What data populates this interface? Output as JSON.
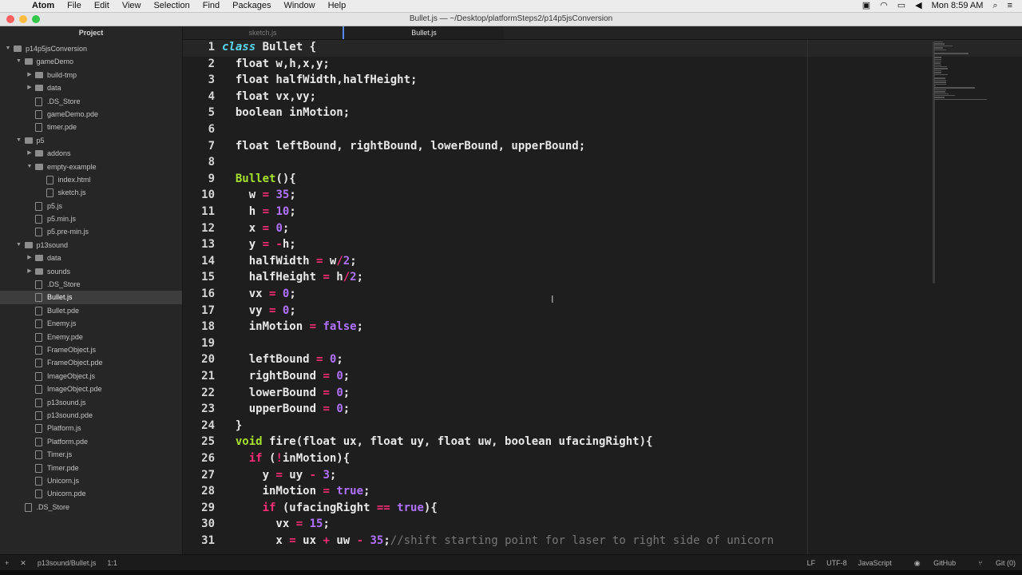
{
  "menubar": {
    "apple": "",
    "app": "Atom",
    "items": [
      "File",
      "Edit",
      "View",
      "Selection",
      "Find",
      "Packages",
      "Window",
      "Help"
    ],
    "clock": "Mon 8:59 AM"
  },
  "window": {
    "title": "Bullet.js — ~/Desktop/platformSteps2/p14p5jsConversion"
  },
  "sidebar": {
    "title": "Project",
    "tree": [
      {
        "label": "p14p5jsConversion",
        "type": "folder",
        "depth": 0,
        "open": true
      },
      {
        "label": "gameDemo",
        "type": "folder",
        "depth": 1,
        "open": true
      },
      {
        "label": "build-tmp",
        "type": "folder",
        "depth": 2,
        "open": false
      },
      {
        "label": "data",
        "type": "folder",
        "depth": 2,
        "open": false
      },
      {
        "label": ".DS_Store",
        "type": "file",
        "depth": 2
      },
      {
        "label": "gameDemo.pde",
        "type": "file",
        "depth": 2
      },
      {
        "label": "timer.pde",
        "type": "file",
        "depth": 2
      },
      {
        "label": "p5",
        "type": "folder",
        "depth": 1,
        "open": true
      },
      {
        "label": "addons",
        "type": "folder",
        "depth": 2,
        "open": false
      },
      {
        "label": "empty-example",
        "type": "folder",
        "depth": 2,
        "open": true
      },
      {
        "label": "index.html",
        "type": "file",
        "depth": 3
      },
      {
        "label": "sketch.js",
        "type": "file",
        "depth": 3
      },
      {
        "label": "p5.js",
        "type": "file",
        "depth": 2
      },
      {
        "label": "p5.min.js",
        "type": "file",
        "depth": 2
      },
      {
        "label": "p5.pre-min.js",
        "type": "file",
        "depth": 2
      },
      {
        "label": "p13sound",
        "type": "folder",
        "depth": 1,
        "open": true
      },
      {
        "label": "data",
        "type": "folder",
        "depth": 2,
        "open": false
      },
      {
        "label": "sounds",
        "type": "folder",
        "depth": 2,
        "open": false
      },
      {
        "label": ".DS_Store",
        "type": "file",
        "depth": 2
      },
      {
        "label": "Bullet.js",
        "type": "file",
        "depth": 2,
        "selected": true
      },
      {
        "label": "Bullet.pde",
        "type": "file",
        "depth": 2
      },
      {
        "label": "Enemy.js",
        "type": "file",
        "depth": 2
      },
      {
        "label": "Enemy.pde",
        "type": "file",
        "depth": 2
      },
      {
        "label": "FrameObject.js",
        "type": "file",
        "depth": 2
      },
      {
        "label": "FrameObject.pde",
        "type": "file",
        "depth": 2
      },
      {
        "label": "ImageObject.js",
        "type": "file",
        "depth": 2
      },
      {
        "label": "ImageObject.pde",
        "type": "file",
        "depth": 2
      },
      {
        "label": "p13sound.js",
        "type": "file",
        "depth": 2
      },
      {
        "label": "p13sound.pde",
        "type": "file",
        "depth": 2
      },
      {
        "label": "Platform.js",
        "type": "file",
        "depth": 2
      },
      {
        "label": "Platform.pde",
        "type": "file",
        "depth": 2
      },
      {
        "label": "Timer.js",
        "type": "file",
        "depth": 2
      },
      {
        "label": "Timer.pde",
        "type": "file",
        "depth": 2
      },
      {
        "label": "Unicorn.js",
        "type": "file",
        "depth": 2
      },
      {
        "label": "Unicorn.pde",
        "type": "file",
        "depth": 2
      },
      {
        "label": ".DS_Store",
        "type": "file",
        "depth": 1
      }
    ]
  },
  "tabs": [
    {
      "label": "sketch.js",
      "active": false
    },
    {
      "label": "Bullet.js",
      "active": true
    }
  ],
  "editor": {
    "current_line": 1,
    "lines": [
      {
        "n": "1",
        "t": [
          [
            "ty",
            "class"
          ],
          [
            "p",
            " Bullet {"
          ]
        ]
      },
      {
        "n": "2",
        "t": [
          [
            "p",
            "  float w,h,x,y;"
          ]
        ]
      },
      {
        "n": "3",
        "t": [
          [
            "p",
            "  float halfWidth,halfHeight;"
          ]
        ]
      },
      {
        "n": "4",
        "t": [
          [
            "p",
            "  float vx,vy;"
          ]
        ]
      },
      {
        "n": "5",
        "t": [
          [
            "p",
            "  boolean inMotion;"
          ]
        ]
      },
      {
        "n": "6",
        "t": []
      },
      {
        "n": "7",
        "t": [
          [
            "p",
            "  float leftBound, rightBound, lowerBound, upperBound;"
          ]
        ]
      },
      {
        "n": "8",
        "t": []
      },
      {
        "n": "9",
        "t": [
          [
            "p",
            "  "
          ],
          [
            "cls",
            "Bullet"
          ],
          [
            "p",
            "(){"
          ]
        ]
      },
      {
        "n": "10",
        "t": [
          [
            "p",
            "    w "
          ],
          [
            "op",
            "="
          ],
          [
            "p",
            " "
          ],
          [
            "num",
            "35"
          ],
          [
            "p",
            ";"
          ]
        ]
      },
      {
        "n": "11",
        "t": [
          [
            "p",
            "    h "
          ],
          [
            "op",
            "="
          ],
          [
            "p",
            " "
          ],
          [
            "num",
            "10"
          ],
          [
            "p",
            ";"
          ]
        ]
      },
      {
        "n": "12",
        "t": [
          [
            "p",
            "    x "
          ],
          [
            "op",
            "="
          ],
          [
            "p",
            " "
          ],
          [
            "num",
            "0"
          ],
          [
            "p",
            ";"
          ]
        ]
      },
      {
        "n": "13",
        "t": [
          [
            "p",
            "    y "
          ],
          [
            "op",
            "= -"
          ],
          [
            "p",
            "h;"
          ]
        ]
      },
      {
        "n": "14",
        "t": [
          [
            "p",
            "    halfWidth "
          ],
          [
            "op",
            "="
          ],
          [
            "p",
            " w"
          ],
          [
            "op",
            "/"
          ],
          [
            "num",
            "2"
          ],
          [
            "p",
            ";"
          ]
        ]
      },
      {
        "n": "15",
        "t": [
          [
            "p",
            "    halfHeight "
          ],
          [
            "op",
            "="
          ],
          [
            "p",
            " h"
          ],
          [
            "op",
            "/"
          ],
          [
            "num",
            "2"
          ],
          [
            "p",
            ";"
          ]
        ]
      },
      {
        "n": "16",
        "t": [
          [
            "p",
            "    vx "
          ],
          [
            "op",
            "="
          ],
          [
            "p",
            " "
          ],
          [
            "num",
            "0"
          ],
          [
            "p",
            ";"
          ]
        ]
      },
      {
        "n": "17",
        "t": [
          [
            "p",
            "    vy "
          ],
          [
            "op",
            "="
          ],
          [
            "p",
            " "
          ],
          [
            "num",
            "0"
          ],
          [
            "p",
            ";"
          ]
        ]
      },
      {
        "n": "18",
        "t": [
          [
            "p",
            "    inMotion "
          ],
          [
            "op",
            "="
          ],
          [
            "p",
            " "
          ],
          [
            "num",
            "false"
          ],
          [
            "p",
            ";"
          ]
        ]
      },
      {
        "n": "19",
        "t": []
      },
      {
        "n": "20",
        "t": [
          [
            "p",
            "    leftBound "
          ],
          [
            "op",
            "="
          ],
          [
            "p",
            " "
          ],
          [
            "num",
            "0"
          ],
          [
            "p",
            ";"
          ]
        ]
      },
      {
        "n": "21",
        "t": [
          [
            "p",
            "    rightBound "
          ],
          [
            "op",
            "="
          ],
          [
            "p",
            " "
          ],
          [
            "num",
            "0"
          ],
          [
            "p",
            ";"
          ]
        ]
      },
      {
        "n": "22",
        "t": [
          [
            "p",
            "    lowerBound "
          ],
          [
            "op",
            "="
          ],
          [
            "p",
            " "
          ],
          [
            "num",
            "0"
          ],
          [
            "p",
            ";"
          ]
        ]
      },
      {
        "n": "23",
        "t": [
          [
            "p",
            "    upperBound "
          ],
          [
            "op",
            "="
          ],
          [
            "p",
            " "
          ],
          [
            "num",
            "0"
          ],
          [
            "p",
            ";"
          ]
        ]
      },
      {
        "n": "24",
        "t": [
          [
            "p",
            "  }"
          ]
        ]
      },
      {
        "n": "25",
        "t": [
          [
            "p",
            "  "
          ],
          [
            "cls",
            "void"
          ],
          [
            "p",
            " fire(float ux, float uy, float uw, boolean ufacingRight){"
          ]
        ]
      },
      {
        "n": "26",
        "t": [
          [
            "p",
            "    "
          ],
          [
            "kw",
            "if"
          ],
          [
            "p",
            " ("
          ],
          [
            "op",
            "!"
          ],
          [
            "p",
            "inMotion){"
          ]
        ]
      },
      {
        "n": "27",
        "t": [
          [
            "p",
            "      y "
          ],
          [
            "op",
            "="
          ],
          [
            "p",
            " uy "
          ],
          [
            "op",
            "-"
          ],
          [
            "p",
            " "
          ],
          [
            "num",
            "3"
          ],
          [
            "p",
            ";"
          ]
        ]
      },
      {
        "n": "28",
        "t": [
          [
            "p",
            "      inMotion "
          ],
          [
            "op",
            "="
          ],
          [
            "p",
            " "
          ],
          [
            "num",
            "true"
          ],
          [
            "p",
            ";"
          ]
        ]
      },
      {
        "n": "29",
        "t": [
          [
            "p",
            "      "
          ],
          [
            "kw",
            "if"
          ],
          [
            "p",
            " (ufacingRight "
          ],
          [
            "op",
            "=="
          ],
          [
            "p",
            " "
          ],
          [
            "num",
            "true"
          ],
          [
            "p",
            "){"
          ]
        ]
      },
      {
        "n": "30",
        "t": [
          [
            "p",
            "        vx "
          ],
          [
            "op",
            "="
          ],
          [
            "p",
            " "
          ],
          [
            "num",
            "15"
          ],
          [
            "p",
            ";"
          ]
        ]
      },
      {
        "n": "31",
        "t": [
          [
            "p",
            "        x "
          ],
          [
            "op",
            "="
          ],
          [
            "p",
            " ux "
          ],
          [
            "op",
            "+"
          ],
          [
            "p",
            " uw "
          ],
          [
            "op",
            "-"
          ],
          [
            "p",
            " "
          ],
          [
            "num",
            "35"
          ],
          [
            "p",
            ";"
          ],
          [
            "cm",
            "//shift starting point for laser to right side of unicorn"
          ]
        ]
      }
    ]
  },
  "statusbar": {
    "add": "+",
    "close": "✕",
    "file": "p13sound/Bullet.js",
    "cursor": "1:1",
    "line_ending": "LF",
    "encoding": "UTF-8",
    "grammar": "JavaScript",
    "github": "GitHub",
    "git": "Git (0)"
  }
}
